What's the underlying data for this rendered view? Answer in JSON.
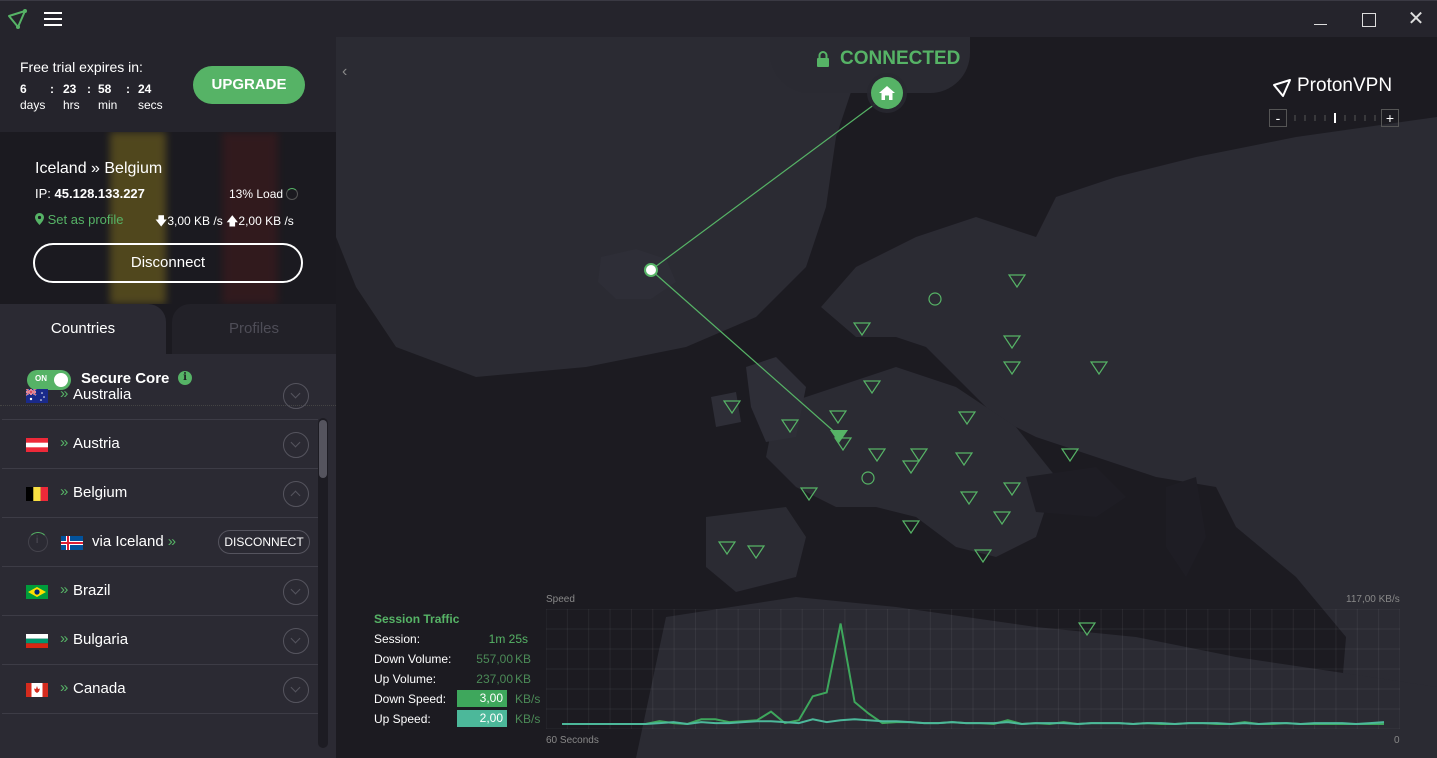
{
  "window": {
    "title_icons": [
      "protonvpn-logo-icon",
      "hamburger-menu-icon"
    ],
    "controls": [
      "minimize",
      "maximize",
      "close"
    ],
    "close_glyph": "✕"
  },
  "trial": {
    "label": "Free trial expires in:",
    "days": "6",
    "days_unit": "days",
    "hrs": "23",
    "hrs_unit": "hrs",
    "min": "58",
    "min_unit": "min",
    "secs": "24",
    "secs_unit": "secs",
    "separator": ":",
    "upgrade_label": "UPGRADE"
  },
  "connection": {
    "route": "Iceland » Belgium",
    "ip_label": "IP:",
    "ip": "45.128.133.227",
    "load": "13% Load",
    "set_profile": "Set as profile",
    "down_speed": "3,00 KB /s",
    "up_speed": "2,00 KB /s",
    "disconnect_label": "Disconnect"
  },
  "tabs": {
    "countries": "Countries",
    "profiles": "Profiles",
    "active": "countries"
  },
  "secure_core": {
    "toggle_label": "ON",
    "enabled": true,
    "label": "Secure Core"
  },
  "countries": [
    {
      "name": "Australia",
      "flag": "au",
      "expanded": false
    },
    {
      "name": "Austria",
      "flag": "at",
      "expanded": false
    },
    {
      "name": "Belgium",
      "flag": "be",
      "expanded": true
    },
    {
      "name": "Brazil",
      "flag": "br",
      "expanded": false
    },
    {
      "name": "Bulgaria",
      "flag": "bg",
      "expanded": false
    },
    {
      "name": "Canada",
      "flag": "ca",
      "expanded": false
    }
  ],
  "belgium_server": {
    "name": "via Iceland",
    "chevron": "»",
    "flag": "is",
    "disconnect_label": "DISCONNECT"
  },
  "country_chevron": "»",
  "map": {
    "status": "CONNECTED",
    "brand": "ProtonVPN",
    "zoom_minus": "-",
    "zoom_plus": "+",
    "collapse_glyph": "‹",
    "accent": "#56b366"
  },
  "session_traffic": {
    "title": "Session Traffic",
    "session_label": "Session:",
    "session_value": "1m 25s",
    "down_volume_label": "Down Volume:",
    "down_volume_value": "557,00",
    "down_volume_unit": "KB",
    "up_volume_label": "Up Volume:",
    "up_volume_value": "237,00",
    "up_volume_unit": "KB",
    "down_speed_label": "Down Speed:",
    "down_speed_value": "3,00",
    "down_speed_unit": "KB/s",
    "up_speed_label": "Up Speed:",
    "up_speed_value": "2,00",
    "up_speed_unit": "KB/s"
  },
  "chart_data": {
    "type": "line",
    "title": "Speed",
    "xlabel": "60 Seconds",
    "ymax_label": "117,00  KB/s",
    "xmin_label": "0",
    "ylim": [
      0,
      117
    ],
    "grid": true,
    "series": [
      {
        "name": "Down Speed",
        "color": "#3ea75c",
        "values": [
          1,
          1,
          1,
          1,
          1,
          1,
          1,
          4,
          2,
          1,
          6,
          6,
          3,
          4,
          5,
          14,
          2,
          5,
          30,
          34,
          106,
          24,
          12,
          2,
          3,
          3,
          2,
          2,
          3,
          2,
          2,
          1,
          5,
          1,
          2,
          1,
          3,
          1,
          2,
          2,
          2,
          1,
          2,
          1,
          1,
          2,
          2,
          1,
          1,
          3,
          1,
          1,
          2,
          1,
          1,
          1,
          1,
          1,
          1,
          1
        ]
      },
      {
        "name": "Up Speed",
        "color": "#4cb89a",
        "values": [
          1,
          1,
          1,
          1,
          1,
          1,
          1,
          2,
          3,
          1,
          3,
          2,
          2,
          3,
          4,
          4,
          3,
          2,
          6,
          3,
          5,
          6,
          5,
          4,
          4,
          3,
          2,
          2,
          3,
          2,
          2,
          2,
          3,
          1,
          2,
          2,
          2,
          1,
          2,
          2,
          2,
          1,
          2,
          2,
          1,
          2,
          2,
          2,
          1,
          2,
          1,
          2,
          2,
          1,
          2,
          2,
          2,
          1,
          2,
          3
        ]
      }
    ]
  }
}
